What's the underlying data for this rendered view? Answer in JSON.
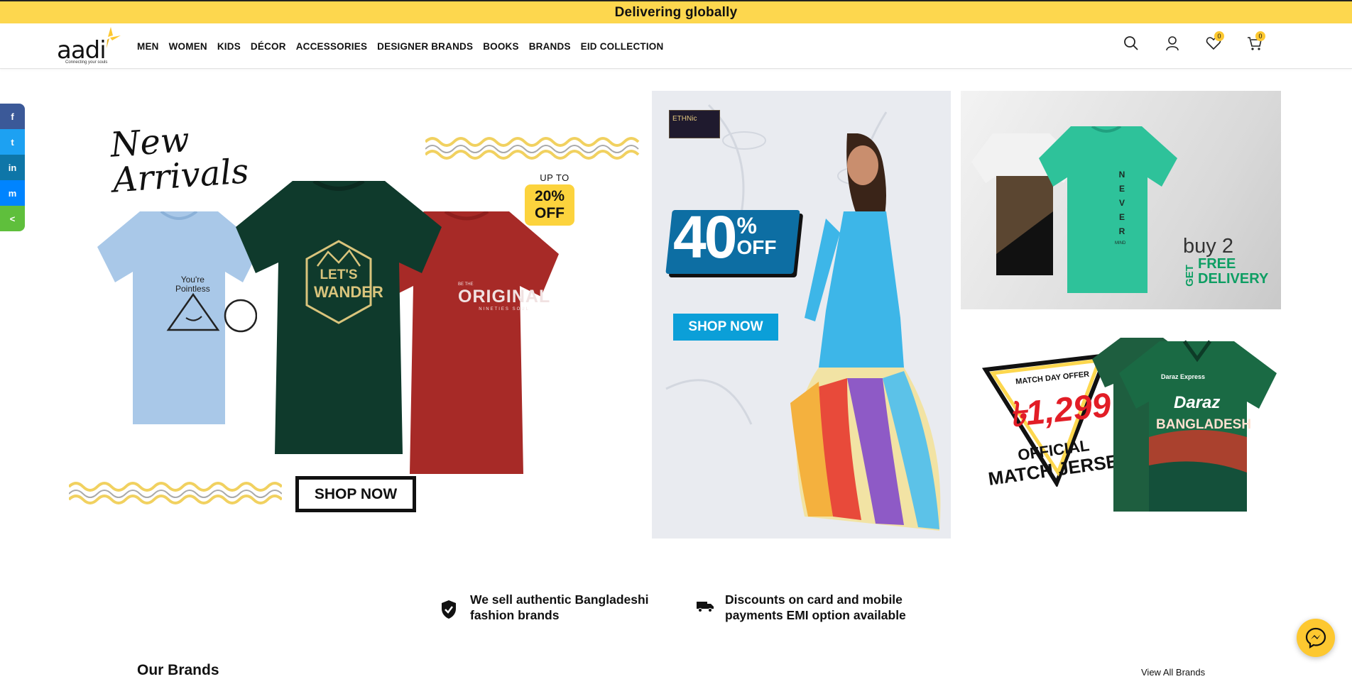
{
  "topbar": {
    "text": "Delivering globally"
  },
  "logo": {
    "text": "aadi",
    "tagline": "Connecting your souls"
  },
  "nav": [
    "MEN",
    "WOMEN",
    "KIDS",
    "DÉCOR",
    "ACCESSORIES",
    "DESIGNER BRANDS",
    "BOOKS",
    "BRANDS",
    "EID COLLECTION"
  ],
  "header_icons": {
    "wishlist_count": "0",
    "cart_count": "0"
  },
  "social": [
    {
      "icon": "facebook-icon",
      "glyph": "f",
      "color": "#3b5998"
    },
    {
      "icon": "twitter-icon",
      "glyph": "t",
      "color": "#1da1f2"
    },
    {
      "icon": "linkedin-icon",
      "glyph": "in",
      "color": "#0e76a8"
    },
    {
      "icon": "messenger-icon",
      "glyph": "m",
      "color": "#0084ff"
    },
    {
      "icon": "share-icon",
      "glyph": "<",
      "color": "#5fbf3c"
    }
  ],
  "banner1": {
    "title_line1": "New",
    "title_line2": "Arrivals",
    "badge_top": "UP TO",
    "badge_line1": "20%",
    "badge_line2": "OFF",
    "shirt1_line1": "You're",
    "shirt1_line2": "Pointless",
    "shirt2_line1": "LET'S",
    "shirt2_line2": "WANDER",
    "shirt3_pre": "BE THE",
    "shirt3_text": "ORIGINAL",
    "shirt3_sub": "NINETIES SOUL",
    "button": "SHOP NOW"
  },
  "banner2": {
    "brand": "ETHNic",
    "percent": "40",
    "percent_sign": "%",
    "off": "OFF",
    "button": "SHOP NOW"
  },
  "banner3": {
    "shirt_text": "NEVER",
    "shirt_sub": "MIND",
    "buy": "buy 2",
    "get": "GET",
    "free": "FREE",
    "delivery": "DELIVERY"
  },
  "banner4": {
    "match_day": "MATCH DAY OFFER",
    "price": "৳1,299",
    "official": "OFFICIAL",
    "jersey": "MATCH JERSEY",
    "shirt_brand": "Daraz",
    "shirt_brand_small": "Daraz Express",
    "shirt_country": "BANGLADESH"
  },
  "features": [
    {
      "icon": "shield-check-icon",
      "line1": "We sell authentic Bangladeshi",
      "line2": "fashion brands"
    },
    {
      "icon": "delivery-truck-icon",
      "line1": "Discounts on card and mobile",
      "line2": "payments EMI option available"
    }
  ],
  "brands": {
    "title": "Our Brands",
    "view_all": "View All Brands"
  },
  "colors": {
    "accent": "#fdd74e",
    "cyan": "#0b9fd8",
    "green": "#2f8f5b"
  }
}
